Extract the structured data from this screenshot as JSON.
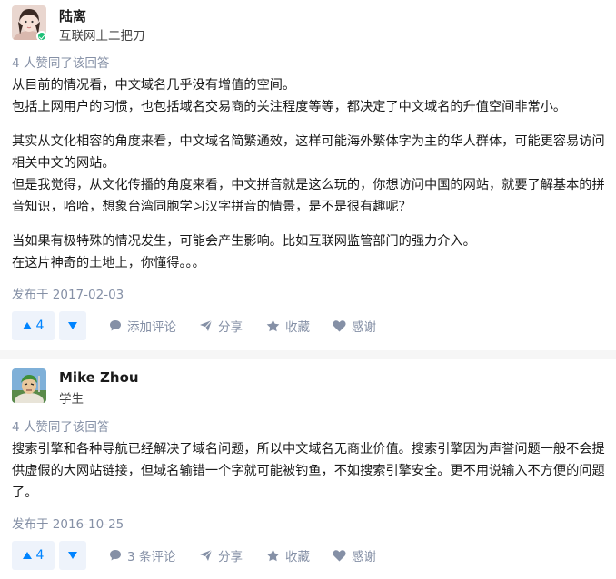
{
  "answers": [
    {
      "author": {
        "name": "陆离",
        "bio": "互联网上二把刀"
      },
      "voters": "4 人赞同了该回答",
      "paragraphs": [
        "从目前的情况看，中文域名几乎没有增值的空间。",
        "包括上网用户的习惯，也包括域名交易商的关注程度等等，都决定了中文域名的升值空间非常小。",
        "",
        "其实从文化相容的角度来看，中文域名简繁通效，这样可能海外繁体字为主的华人群体，可能更容易访问相关中文的网站。",
        "但是我觉得，从文化传播的角度来看，中文拼音就是这么玩的，你想访问中国的网站，就要了解基本的拼音知识，哈哈，想象台湾同胞学习汉字拼音的情景，是不是很有趣呢？",
        "",
        "当如果有极特殊的情况发生，可能会产生影响。比如互联网监管部门的强力介入。",
        "在这片神奇的土地上，你懂得。。。"
      ],
      "published": "发布于 2017-02-03",
      "actions": {
        "upvote_count": "4",
        "comment": "添加评论",
        "share": "分享",
        "collect": "收藏",
        "thanks": "感谢"
      }
    },
    {
      "author": {
        "name": "Mike Zhou",
        "bio": "学生"
      },
      "voters": "4 人赞同了该回答",
      "paragraphs": [
        "搜索引擎和各种导航已经解决了域名问题，所以中文域名无商业价值。搜索引擎因为声誉问题一般不会提供虚假的大网站链接，但域名输错一个字就可能被钓鱼，不如搜索引擎安全。更不用说输入不方便的问题了。"
      ],
      "published": "发布于 2016-10-25",
      "actions": {
        "upvote_count": "4",
        "comment": "3 条评论",
        "share": "分享",
        "collect": "收藏",
        "thanks": "感谢"
      }
    }
  ],
  "colors": {
    "accent": "#0084ff",
    "meta": "#8590a6",
    "vote_bg": "#eef3fb",
    "verified": "#1dbf76"
  }
}
